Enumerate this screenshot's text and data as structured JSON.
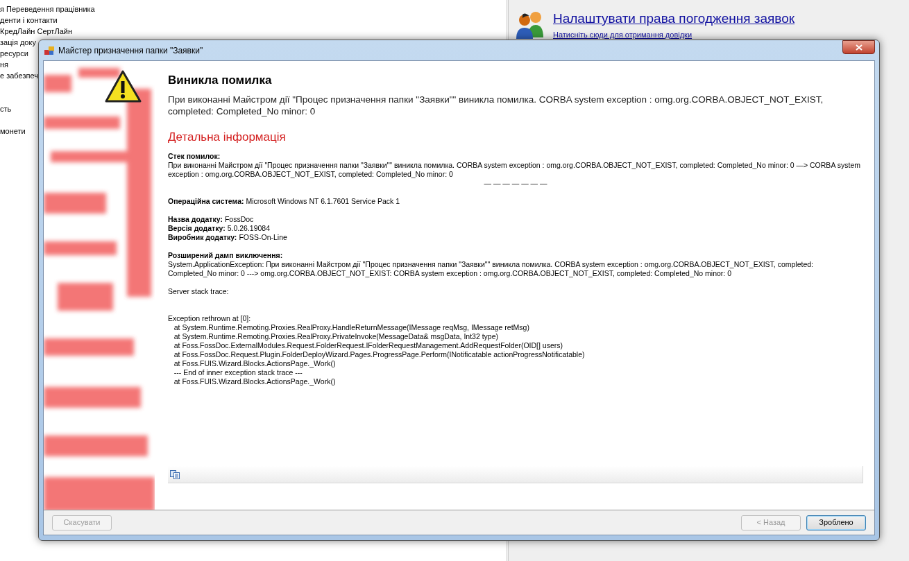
{
  "background_list": [
    {
      "kind": "item",
      "label": "я Переведення працівника"
    },
    {
      "kind": "item",
      "label": "денти і контакти"
    },
    {
      "kind": "item",
      "label": "КредЛайн СертЛайн"
    },
    {
      "kind": "item",
      "label": "зація доку"
    },
    {
      "kind": "item",
      "label": "ресурси"
    },
    {
      "kind": "item",
      "label": "ня"
    },
    {
      "kind": "item",
      "label": "е забезпеч"
    },
    {
      "kind": "blank"
    },
    {
      "kind": "blank"
    },
    {
      "kind": "item",
      "label": "сть"
    },
    {
      "kind": "blank"
    },
    {
      "kind": "item",
      "label": "монети"
    }
  ],
  "help_link": {
    "title": "Налаштувати права погодження заявок",
    "hint": "Натисніть сюди для отримання довідки"
  },
  "window": {
    "title": "Майстер призначення папки \"Заявки\""
  },
  "error": {
    "heading": "Виникла помилка",
    "message": "При виконанні Майстром дії \"Процес призначення папки \"Заявки\"\" виникла помилка. CORBA system exception : omg.org.CORBA.OBJECT_NOT_EXIST, completed: Completed_No minor: 0",
    "details_heading": "Детальна інформація"
  },
  "details": [
    {
      "kind": "stacked",
      "label": "Стек помилок:",
      "text": "При виконанні Майстром дії \"Процес призначення папки \"Заявки\"\" виникла помилка. CORBA system exception : omg.org.CORBA.OBJECT_NOT_EXIST, completed: Completed_No minor: 0 —> CORBA system exception : omg.org.CORBA.OBJECT_NOT_EXIST, completed: Completed_No minor: 0"
    },
    {
      "kind": "separator",
      "text": "— — — — — — —"
    },
    {
      "kind": "inline",
      "label": "Операційна система:",
      "text": "Microsoft Windows NT 6.1.7601 Service Pack 1"
    },
    {
      "kind": "gap"
    },
    {
      "kind": "inline",
      "label": "Назва додатку:",
      "text": "FossDoc"
    },
    {
      "kind": "inline",
      "label": "Версія додатку:",
      "text": "5.0.26.19084"
    },
    {
      "kind": "inline",
      "label": "Виробник додатку:",
      "text": "FOSS-On-Line"
    },
    {
      "kind": "gap"
    },
    {
      "kind": "stacked",
      "label": "Розширений дамп виключення:",
      "text": "System.ApplicationException: При виконанні Майстром дії \"Процес призначення папки \"Заявки\"\" виникла помилка. CORBA system exception : omg.org.CORBA.OBJECT_NOT_EXIST, completed: Completed_No minor: 0 ---> omg.org.CORBA.OBJECT_NOT_EXIST: CORBA system exception : omg.org.CORBA.OBJECT_NOT_EXIST, completed: Completed_No minor: 0"
    },
    {
      "kind": "gap"
    },
    {
      "kind": "line",
      "text": "Server stack trace:"
    },
    {
      "kind": "gap"
    },
    {
      "kind": "gap"
    },
    {
      "kind": "line",
      "text": "Exception rethrown at [0]:"
    },
    {
      "kind": "line",
      "text": "   at System.Runtime.Remoting.Proxies.RealProxy.HandleReturnMessage(IMessage reqMsg, IMessage retMsg)"
    },
    {
      "kind": "line",
      "text": "   at System.Runtime.Remoting.Proxies.RealProxy.PrivateInvoke(MessageData& msgData, Int32 type)"
    },
    {
      "kind": "line",
      "text": "   at Foss.FossDoc.ExternalModules.Request.FolderRequest.IFolderRequestManagement.AddRequestFolder(OID[] users)"
    },
    {
      "kind": "line",
      "text": "   at Foss.FossDoc.Request.Plugin.FolderDeployWizard.Pages.ProgressPage.Perform(INotificatable actionProgressNotificatable)"
    },
    {
      "kind": "line",
      "text": "   at Foss.FUIS.Wizard.Blocks.ActionsPage._Work()"
    },
    {
      "kind": "line",
      "text": "   --- End of inner exception stack trace ---"
    },
    {
      "kind": "line",
      "text": "   at Foss.FUIS.Wizard.Blocks.ActionsPage._Work()"
    }
  ],
  "buttons": [
    {
      "label": "Скасувати",
      "disabled": true,
      "default": false
    },
    {
      "label": "< Назад",
      "disabled": true,
      "default": false
    },
    {
      "label": "Зроблено",
      "disabled": false,
      "default": true
    }
  ]
}
